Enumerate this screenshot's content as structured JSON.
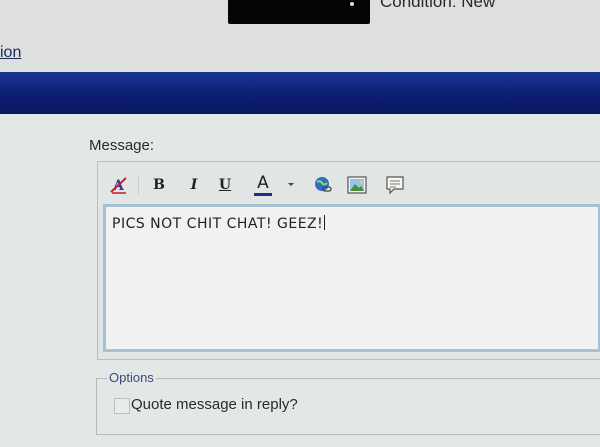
{
  "top": {
    "condition_text": "Condition: New",
    "link_text": "ion"
  },
  "message": {
    "label": "Message:",
    "text": "PICS NOT CHIT CHAT! GEEZ!"
  },
  "toolbar": {
    "font_icon": "font-format-icon",
    "bold_label": "B",
    "italic_label": "I",
    "underline_label": "U",
    "color_label": "A",
    "link_icon": "insert-link-icon",
    "image_icon": "insert-image-icon",
    "quote_icon": "insert-quote-icon"
  },
  "options": {
    "legend": "Options",
    "quote_checkbox_label": "Quote message in reply?",
    "quote_checked": false
  },
  "colors": {
    "header_bar": "#0c1e73",
    "textarea_border": "#a7c1d3",
    "options_legend": "#3a4c7c",
    "font_color_underline": "#1f2d8a"
  }
}
